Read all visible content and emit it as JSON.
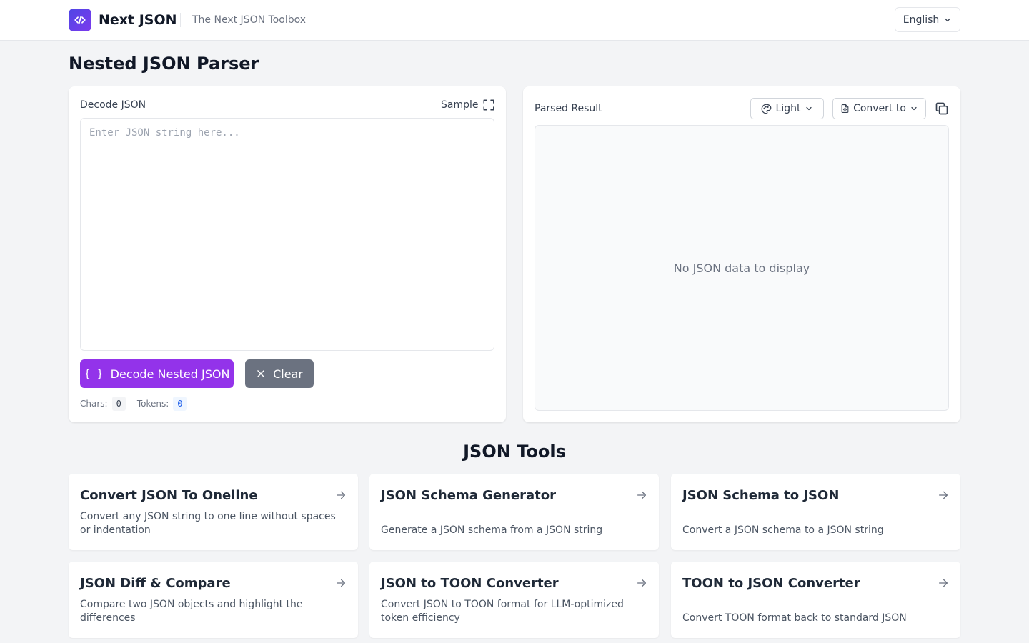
{
  "header": {
    "brand": "Next JSON",
    "tagline": "The Next JSON Toolbox",
    "language": "English"
  },
  "page": {
    "title": "Nested JSON Parser"
  },
  "input_panel": {
    "label": "Decode JSON",
    "sample_label": "Sample",
    "placeholder": "Enter JSON string here...",
    "decode_label": "Decode Nested JSON",
    "clear_label": "Clear",
    "chars_label": "Chars:",
    "chars_value": "0",
    "tokens_label": "Tokens:",
    "tokens_value": "0"
  },
  "result_panel": {
    "label": "Parsed Result",
    "theme_label": "Light",
    "convert_label": "Convert to",
    "empty_message": "No JSON data to display"
  },
  "tools": {
    "title": "JSON Tools",
    "items": [
      {
        "title": "Convert JSON To Oneline",
        "desc": "Convert any JSON string to one line without spaces or indentation"
      },
      {
        "title": "JSON Schema Generator",
        "desc": "Generate a JSON schema from a JSON string"
      },
      {
        "title": "JSON Schema to JSON",
        "desc": "Convert a JSON schema to a JSON string"
      },
      {
        "title": "JSON Diff & Compare",
        "desc": "Compare two JSON objects and highlight the differences"
      },
      {
        "title": "JSON to TOON Converter",
        "desc": "Convert JSON to TOON format for LLM-optimized token efficiency"
      },
      {
        "title": "TOON to JSON Converter",
        "desc": "Convert TOON format back to standard JSON"
      }
    ]
  },
  "colors": {
    "primary": "#9333ea",
    "secondary": "#6b7280",
    "logo_start": "#4f46e5",
    "logo_end": "#7c3aed",
    "background": "#f3f4f6"
  }
}
